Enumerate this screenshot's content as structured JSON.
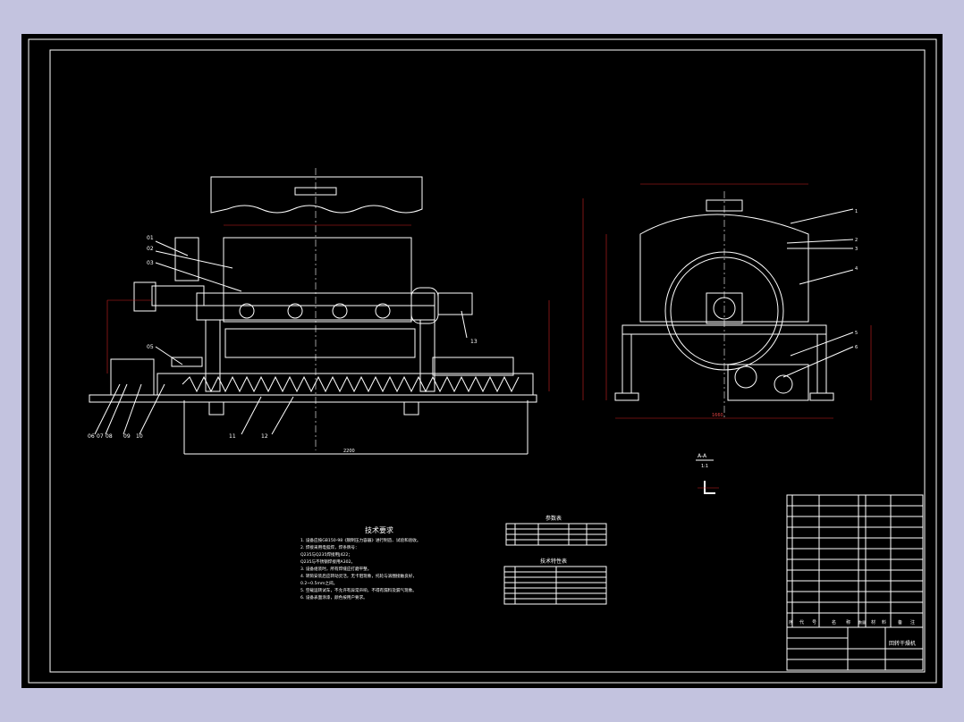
{
  "drawing": {
    "title_block": {
      "drawing_name": "回转干燥机",
      "header_cells": [
        "序",
        "代",
        "号",
        "名",
        "称",
        "数量",
        "材",
        "料",
        "备",
        "注"
      ]
    },
    "tech_requirements": {
      "title": "技术要求",
      "lines": [
        "1. 设备应按GB150-98《钢制压力容器》进行制造、试验和验收。",
        "2. 焊接采用电弧焊，焊条牌号：",
        "   Q235与Q235焊接用J422；",
        "   Q235与不锈钢焊接用A302。",
        "3. 设备组装时，所有焊缝应打磨平整。",
        "4. 转筒安装后应转动灵活，无卡阻现象，托轮与滚圈接触良好，",
        "   0.2~0.5mm之间。",
        "5. 空载运转试车，不允许有异常声响，不得有漏料及漏气现象。",
        "6. 设备表面涂漆，颜色按用户要求。"
      ]
    },
    "table_1_title": "参数表",
    "table_2_title": "技术特性表",
    "section_label": "A-A",
    "section_scale": "1:1",
    "callouts_front": [
      "01",
      "02",
      "03",
      "05",
      "06",
      "07",
      "08",
      "09",
      "10",
      "11",
      "12",
      "13"
    ],
    "callouts_side": [
      "1",
      "2",
      "3",
      "4",
      "5",
      "6",
      "7"
    ],
    "dim_front_bottom": "2200",
    "dim_side_bottom": "1660"
  }
}
